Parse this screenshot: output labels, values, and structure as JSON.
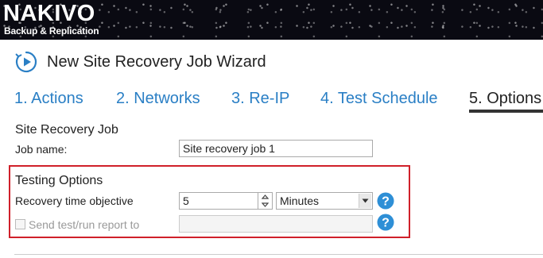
{
  "app": {
    "brand": "NAKIVO",
    "tagline": "Backup & Replication"
  },
  "wizard": {
    "title": "New Site Recovery Job Wizard",
    "icon": "play-circle-icon",
    "steps": [
      {
        "label": "1. Actions",
        "active": false
      },
      {
        "label": "2. Networks",
        "active": false
      },
      {
        "label": "3. Re-IP",
        "active": false
      },
      {
        "label": "4. Test Schedule",
        "active": false
      },
      {
        "label": "5. Options",
        "active": true
      }
    ]
  },
  "site_recovery_job": {
    "section_title": "Site Recovery Job",
    "job_name_label": "Job name:",
    "job_name_value": "Site recovery job 1"
  },
  "testing_options": {
    "section_title": "Testing Options",
    "rto_label": "Recovery time objective",
    "rto_value": "5",
    "rto_unit": "Minutes",
    "send_report_label": "Send test/run report to",
    "send_report_checked": false,
    "send_report_value": "",
    "help_icon": "help-icon"
  },
  "colors": {
    "accent": "#2a7fc5",
    "highlight_border": "#d0202a",
    "help_icon": "#2e8fd6"
  }
}
